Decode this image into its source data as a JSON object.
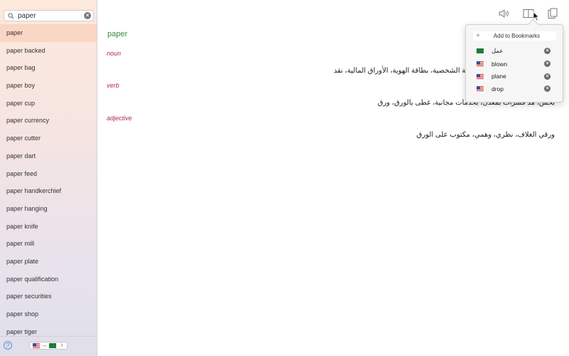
{
  "search": {
    "value": "paper",
    "placeholder": ""
  },
  "word_list": [
    "paper",
    "paper backed",
    "paper bag",
    "paper boy",
    "paper cup",
    "paper currency",
    "paper cutter",
    "paper dart",
    "paper feed",
    "paper handkerchief",
    "paper hanging",
    "paper knife",
    "paper mill",
    "paper plate",
    "paper qualification",
    "paper securities",
    "paper shop",
    "paper tiger"
  ],
  "selected_index": 0,
  "footer": {
    "help_label": "?",
    "lang_swap": "↔"
  },
  "entry": {
    "headword": "paper",
    "senses": [
      {
        "pos": "noun",
        "definition": "ة، ورق، الأوراق الثبوتية، البطاقة الشخصية، بطاقة الهوية، الأوراق المالية، نقد"
      },
      {
        "pos": "verb",
        "definition": "بخس، مد فشرات بمعدل، بخدمات مجانية، غطى بالورق، ورق"
      },
      {
        "pos": "adjective",
        "definition": "ورقي الغلاف، نظري، وهمي، مكتوب على الورق"
      }
    ]
  },
  "bookmarks": {
    "add_label": "Add to Bookmarks",
    "items": [
      {
        "word": "عمل",
        "flag": "sa"
      },
      {
        "word": "blown",
        "flag": "us"
      },
      {
        "word": "plane",
        "flag": "us"
      },
      {
        "word": "drop",
        "flag": "us"
      }
    ]
  },
  "icons": [
    "search-icon",
    "clear-icon",
    "speaker-icon",
    "bookmarks-icon",
    "copy-icon",
    "help-icon"
  ],
  "colors": {
    "headword": "#3a8a3a",
    "pos": "#b0285a",
    "selected_row": "#fac8af"
  }
}
